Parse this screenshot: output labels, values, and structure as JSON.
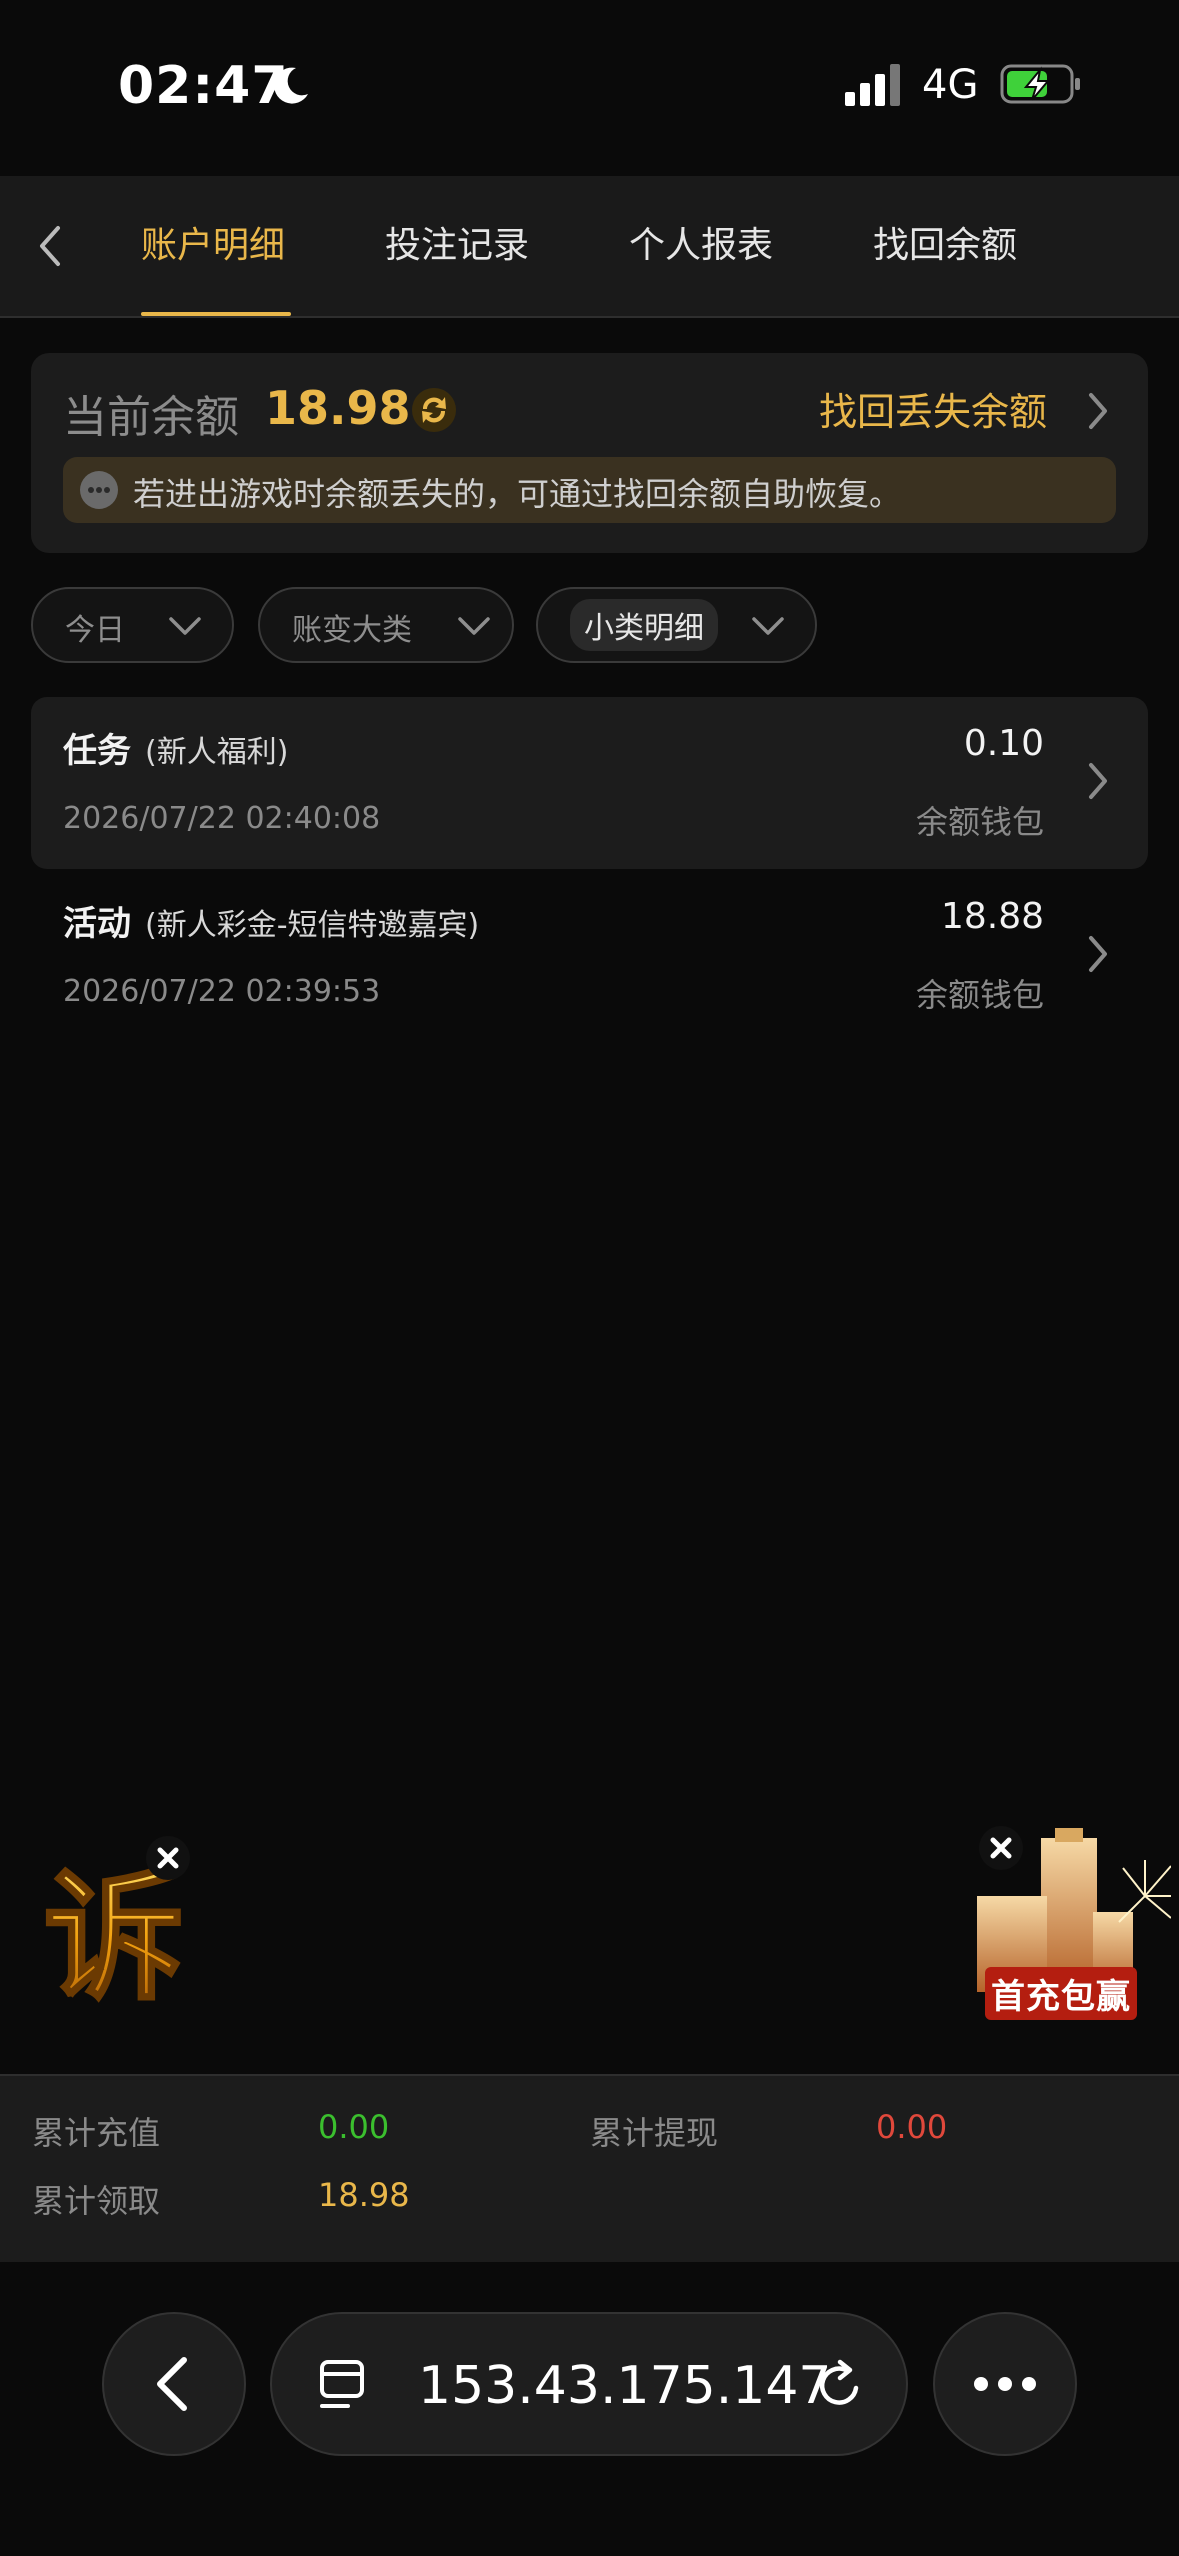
{
  "status_bar": {
    "time": "02:47",
    "network": "4G",
    "icons": [
      "moon-icon",
      "signal-icon",
      "battery-charging-icon"
    ]
  },
  "tabs": [
    {
      "label": "账户明细",
      "active": true
    },
    {
      "label": "投注记录",
      "active": false
    },
    {
      "label": "个人报表",
      "active": false
    },
    {
      "label": "找回余额",
      "active": false
    }
  ],
  "balance": {
    "label": "当前余额",
    "value": "18.98",
    "recover_link": "找回丢失余额",
    "notice": "若进出游戏时余额丢失的，可通过找回余额自助恢复。"
  },
  "filters": [
    {
      "label": "今日",
      "selected": false
    },
    {
      "label": "账变大类",
      "selected": false
    },
    {
      "label": "小类明细",
      "selected": true
    }
  ],
  "records": [
    {
      "type": "任务",
      "subtype": "(新人福利)",
      "time": "2026/07/22 02:40:08",
      "amount": "0.10",
      "wallet": "余额钱包"
    },
    {
      "type": "活动",
      "subtype": "(新人彩金-短信特邀嘉宾)",
      "time": "2026/07/22 02:39:53",
      "amount": "18.88",
      "wallet": "余额钱包"
    }
  ],
  "floating": {
    "left_glyph": "诉",
    "right_promo": "首充包赢"
  },
  "totals": {
    "recharge_label": "累计充值",
    "recharge_value": "0.00",
    "withdraw_label": "累计提现",
    "withdraw_value": "0.00",
    "claimed_label": "累计领取",
    "claimed_value": "18.98"
  },
  "colors": {
    "accent": "#e9b74a",
    "recharge": "#3bbf2e",
    "withdraw": "#e0483b"
  },
  "browser": {
    "url": "153.43.175.147"
  }
}
